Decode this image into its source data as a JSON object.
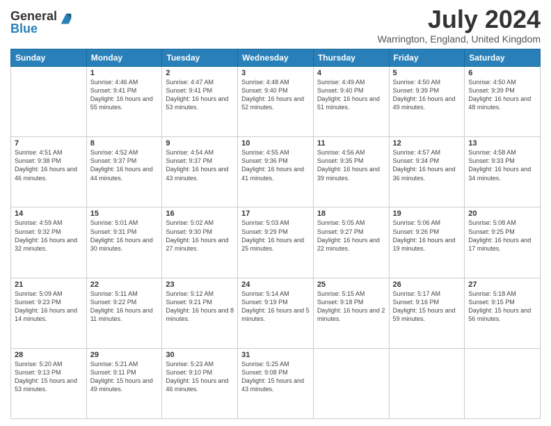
{
  "logo": {
    "general": "General",
    "blue": "Blue"
  },
  "title": "July 2024",
  "subtitle": "Warrington, England, United Kingdom",
  "days_of_week": [
    "Sunday",
    "Monday",
    "Tuesday",
    "Wednesday",
    "Thursday",
    "Friday",
    "Saturday"
  ],
  "weeks": [
    [
      {
        "day": "",
        "sunrise": "",
        "sunset": "",
        "daylight": ""
      },
      {
        "day": "1",
        "sunrise": "Sunrise: 4:46 AM",
        "sunset": "Sunset: 9:41 PM",
        "daylight": "Daylight: 16 hours and 55 minutes."
      },
      {
        "day": "2",
        "sunrise": "Sunrise: 4:47 AM",
        "sunset": "Sunset: 9:41 PM",
        "daylight": "Daylight: 16 hours and 53 minutes."
      },
      {
        "day": "3",
        "sunrise": "Sunrise: 4:48 AM",
        "sunset": "Sunset: 9:40 PM",
        "daylight": "Daylight: 16 hours and 52 minutes."
      },
      {
        "day": "4",
        "sunrise": "Sunrise: 4:49 AM",
        "sunset": "Sunset: 9:40 PM",
        "daylight": "Daylight: 16 hours and 51 minutes."
      },
      {
        "day": "5",
        "sunrise": "Sunrise: 4:50 AM",
        "sunset": "Sunset: 9:39 PM",
        "daylight": "Daylight: 16 hours and 49 minutes."
      },
      {
        "day": "6",
        "sunrise": "Sunrise: 4:50 AM",
        "sunset": "Sunset: 9:39 PM",
        "daylight": "Daylight: 16 hours and 48 minutes."
      }
    ],
    [
      {
        "day": "7",
        "sunrise": "Sunrise: 4:51 AM",
        "sunset": "Sunset: 9:38 PM",
        "daylight": "Daylight: 16 hours and 46 minutes."
      },
      {
        "day": "8",
        "sunrise": "Sunrise: 4:52 AM",
        "sunset": "Sunset: 9:37 PM",
        "daylight": "Daylight: 16 hours and 44 minutes."
      },
      {
        "day": "9",
        "sunrise": "Sunrise: 4:54 AM",
        "sunset": "Sunset: 9:37 PM",
        "daylight": "Daylight: 16 hours and 43 minutes."
      },
      {
        "day": "10",
        "sunrise": "Sunrise: 4:55 AM",
        "sunset": "Sunset: 9:36 PM",
        "daylight": "Daylight: 16 hours and 41 minutes."
      },
      {
        "day": "11",
        "sunrise": "Sunrise: 4:56 AM",
        "sunset": "Sunset: 9:35 PM",
        "daylight": "Daylight: 16 hours and 39 minutes."
      },
      {
        "day": "12",
        "sunrise": "Sunrise: 4:57 AM",
        "sunset": "Sunset: 9:34 PM",
        "daylight": "Daylight: 16 hours and 36 minutes."
      },
      {
        "day": "13",
        "sunrise": "Sunrise: 4:58 AM",
        "sunset": "Sunset: 9:33 PM",
        "daylight": "Daylight: 16 hours and 34 minutes."
      }
    ],
    [
      {
        "day": "14",
        "sunrise": "Sunrise: 4:59 AM",
        "sunset": "Sunset: 9:32 PM",
        "daylight": "Daylight: 16 hours and 32 minutes."
      },
      {
        "day": "15",
        "sunrise": "Sunrise: 5:01 AM",
        "sunset": "Sunset: 9:31 PM",
        "daylight": "Daylight: 16 hours and 30 minutes."
      },
      {
        "day": "16",
        "sunrise": "Sunrise: 5:02 AM",
        "sunset": "Sunset: 9:30 PM",
        "daylight": "Daylight: 16 hours and 27 minutes."
      },
      {
        "day": "17",
        "sunrise": "Sunrise: 5:03 AM",
        "sunset": "Sunset: 9:29 PM",
        "daylight": "Daylight: 16 hours and 25 minutes."
      },
      {
        "day": "18",
        "sunrise": "Sunrise: 5:05 AM",
        "sunset": "Sunset: 9:27 PM",
        "daylight": "Daylight: 16 hours and 22 minutes."
      },
      {
        "day": "19",
        "sunrise": "Sunrise: 5:06 AM",
        "sunset": "Sunset: 9:26 PM",
        "daylight": "Daylight: 16 hours and 19 minutes."
      },
      {
        "day": "20",
        "sunrise": "Sunrise: 5:08 AM",
        "sunset": "Sunset: 9:25 PM",
        "daylight": "Daylight: 16 hours and 17 minutes."
      }
    ],
    [
      {
        "day": "21",
        "sunrise": "Sunrise: 5:09 AM",
        "sunset": "Sunset: 9:23 PM",
        "daylight": "Daylight: 16 hours and 14 minutes."
      },
      {
        "day": "22",
        "sunrise": "Sunrise: 5:11 AM",
        "sunset": "Sunset: 9:22 PM",
        "daylight": "Daylight: 16 hours and 11 minutes."
      },
      {
        "day": "23",
        "sunrise": "Sunrise: 5:12 AM",
        "sunset": "Sunset: 9:21 PM",
        "daylight": "Daylight: 16 hours and 8 minutes."
      },
      {
        "day": "24",
        "sunrise": "Sunrise: 5:14 AM",
        "sunset": "Sunset: 9:19 PM",
        "daylight": "Daylight: 16 hours and 5 minutes."
      },
      {
        "day": "25",
        "sunrise": "Sunrise: 5:15 AM",
        "sunset": "Sunset: 9:18 PM",
        "daylight": "Daylight: 16 hours and 2 minutes."
      },
      {
        "day": "26",
        "sunrise": "Sunrise: 5:17 AM",
        "sunset": "Sunset: 9:16 PM",
        "daylight": "Daylight: 15 hours and 59 minutes."
      },
      {
        "day": "27",
        "sunrise": "Sunrise: 5:18 AM",
        "sunset": "Sunset: 9:15 PM",
        "daylight": "Daylight: 15 hours and 56 minutes."
      }
    ],
    [
      {
        "day": "28",
        "sunrise": "Sunrise: 5:20 AM",
        "sunset": "Sunset: 9:13 PM",
        "daylight": "Daylight: 15 hours and 53 minutes."
      },
      {
        "day": "29",
        "sunrise": "Sunrise: 5:21 AM",
        "sunset": "Sunset: 9:11 PM",
        "daylight": "Daylight: 15 hours and 49 minutes."
      },
      {
        "day": "30",
        "sunrise": "Sunrise: 5:23 AM",
        "sunset": "Sunset: 9:10 PM",
        "daylight": "Daylight: 15 hours and 46 minutes."
      },
      {
        "day": "31",
        "sunrise": "Sunrise: 5:25 AM",
        "sunset": "Sunset: 9:08 PM",
        "daylight": "Daylight: 15 hours and 43 minutes."
      },
      {
        "day": "",
        "sunrise": "",
        "sunset": "",
        "daylight": ""
      },
      {
        "day": "",
        "sunrise": "",
        "sunset": "",
        "daylight": ""
      },
      {
        "day": "",
        "sunrise": "",
        "sunset": "",
        "daylight": ""
      }
    ]
  ]
}
